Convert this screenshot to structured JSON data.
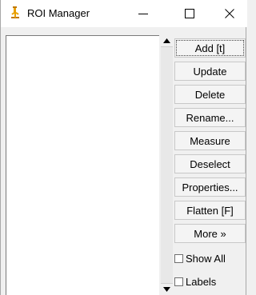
{
  "window": {
    "title": "ROI Manager",
    "icons": {
      "app": "microscope-icon",
      "minimize": "minimize-icon",
      "maximize": "maximize-icon",
      "close": "close-icon"
    }
  },
  "roi_list": {
    "items": []
  },
  "buttons": {
    "add": "Add [t]",
    "update": "Update",
    "delete": "Delete",
    "rename": "Rename...",
    "measure": "Measure",
    "deselect": "Deselect",
    "properties": "Properties...",
    "flatten": "Flatten [F]",
    "more": "More »"
  },
  "checkboxes": {
    "show_all": {
      "label": "Show All",
      "checked": false
    },
    "labels": {
      "label": "Labels",
      "checked": false
    }
  },
  "colors": {
    "icon_accent": "#e8a000"
  }
}
